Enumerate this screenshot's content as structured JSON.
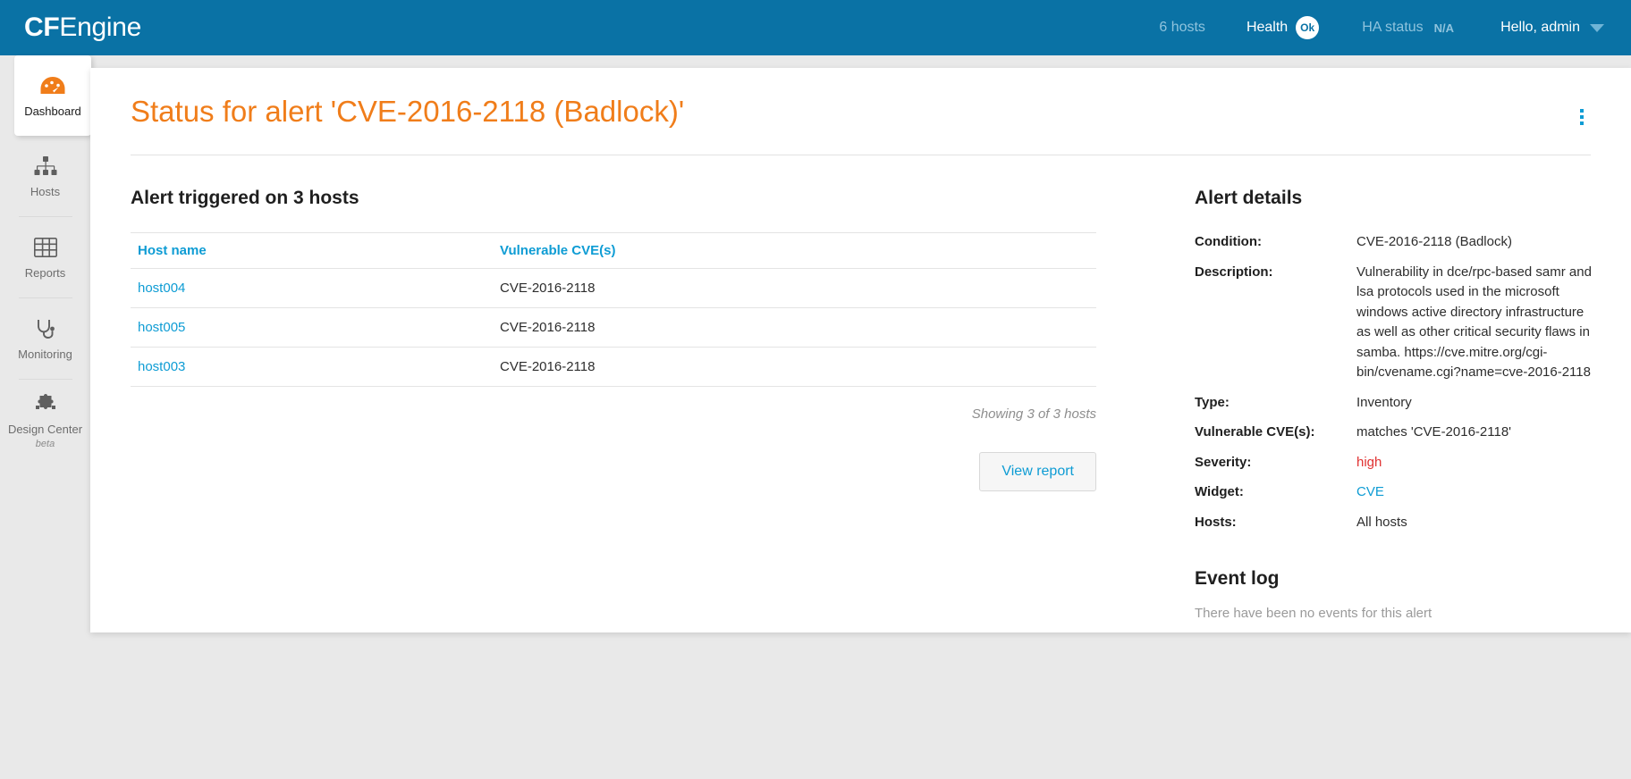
{
  "topbar": {
    "logo_bold": "CF",
    "logo_light": "Engine",
    "hosts_count": "6 hosts",
    "health_label": "Health",
    "health_status": "Ok",
    "ha_label": "HA status",
    "ha_value": "N/A",
    "user_greeting": "Hello, admin",
    "chevron_icon": "chevron-down-icon",
    "accent_color": "#0a72a5"
  },
  "sidebar": {
    "items": [
      {
        "label": "Dashboard",
        "icon": "gauge-icon",
        "active": true,
        "sub": ""
      },
      {
        "label": "Hosts",
        "icon": "org-chart-icon",
        "active": false,
        "sub": ""
      },
      {
        "label": "Reports",
        "icon": "grid-table-icon",
        "active": false,
        "sub": ""
      },
      {
        "label": "Monitoring",
        "icon": "stethoscope-icon",
        "active": false,
        "sub": ""
      },
      {
        "label": "Design Center",
        "icon": "puzzle-piece-icon",
        "active": false,
        "sub": "beta"
      }
    ]
  },
  "page": {
    "title": "Status for alert 'CVE-2016-2118 (Badlock)'",
    "title_color": "#f07d1a",
    "menu_icon": "kebab-menu-icon"
  },
  "hosts_section": {
    "heading": "Alert triggered on 3 hosts",
    "columns": [
      "Host name",
      "Vulnerable CVE(s)"
    ],
    "rows": [
      {
        "host": "host004",
        "cve": "CVE-2016-2118"
      },
      {
        "host": "host005",
        "cve": "CVE-2016-2118"
      },
      {
        "host": "host003",
        "cve": "CVE-2016-2118"
      }
    ],
    "showing": "Showing 3 of 3 hosts",
    "view_report_label": "View report"
  },
  "alert_details": {
    "heading": "Alert details",
    "rows": [
      {
        "key": "Condition:",
        "value": "CVE-2016-2118 (Badlock)",
        "style": "plain"
      },
      {
        "key": "Description:",
        "value": "Vulnerability in dce/rpc-based samr and lsa protocols used in the microsoft windows active directory infrastructure as well as other critical security flaws in samba. https://cve.mitre.org/cgi-bin/cvename.cgi?name=cve-2016-2118",
        "style": "plain"
      },
      {
        "key": "Type:",
        "value": "Inventory",
        "style": "plain"
      },
      {
        "key": "Vulnerable CVE(s):",
        "value": "matches 'CVE-2016-2118'",
        "style": "plain"
      },
      {
        "key": "Severity:",
        "value": "high",
        "style": "severity-high"
      },
      {
        "key": "Widget:",
        "value": "CVE",
        "style": "link"
      },
      {
        "key": "Hosts:",
        "value": "All hosts",
        "style": "plain"
      }
    ],
    "severity_color": "#e03131",
    "link_color": "#0e9cd4"
  },
  "event_log": {
    "heading": "Event log",
    "empty_message": "There have been no events for this alert"
  }
}
